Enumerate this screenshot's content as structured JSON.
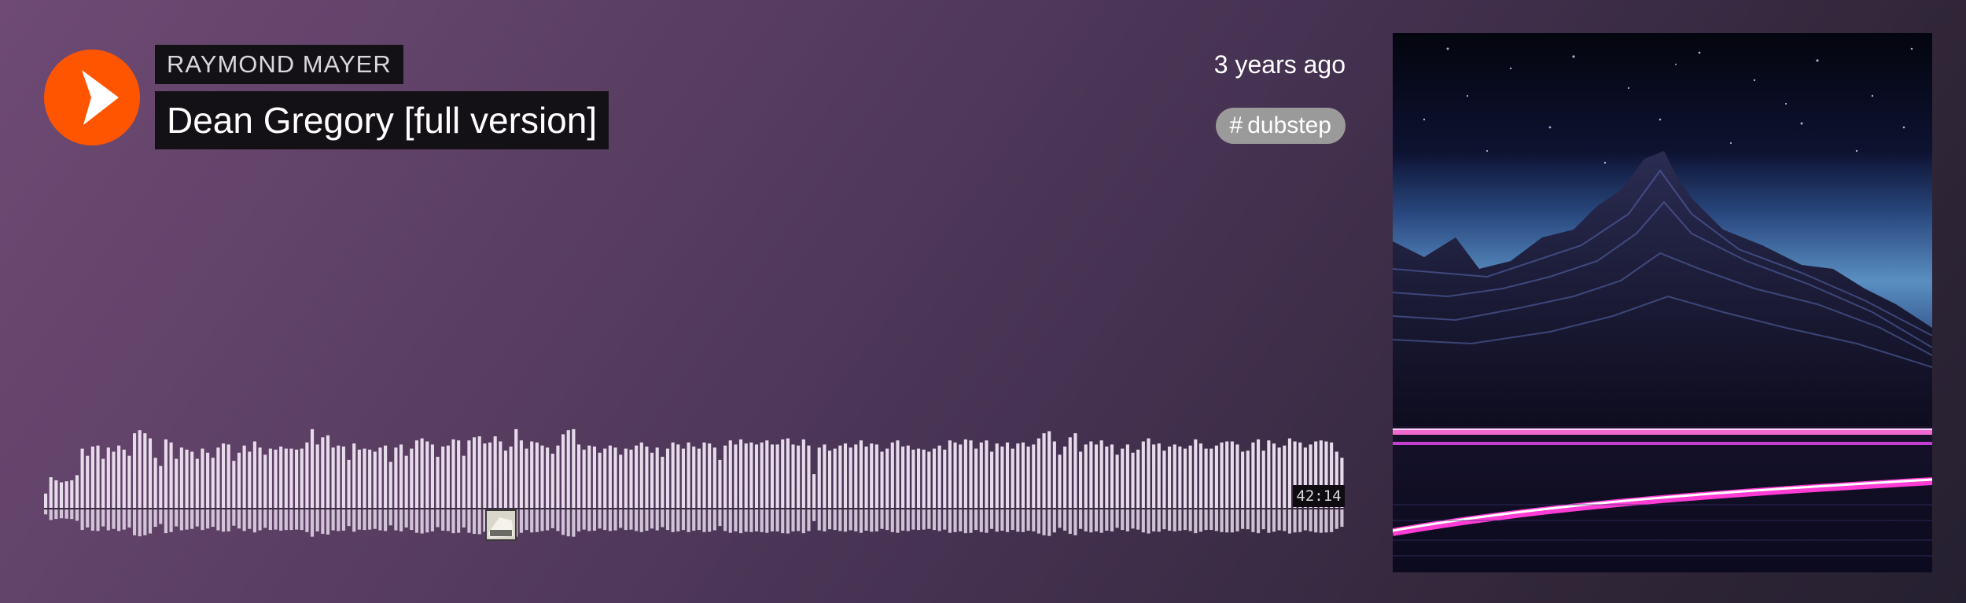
{
  "player": {
    "play_icon": "play-icon",
    "brand_color": "#ff5500"
  },
  "track": {
    "artist": "RAYMOND MAYER",
    "title": "Dean Gregory [full version]",
    "posted": "3 years ago",
    "tag": "dubstep",
    "tag_prefix": "#",
    "duration": "42:14"
  },
  "waveform": {
    "bar_color": "#e8dcec",
    "bars": [
      0.14,
      0.3,
      0.27,
      0.25,
      0.26,
      0.27,
      0.32,
      0.58,
      0.51,
      0.6,
      0.61,
      0.48,
      0.59,
      0.55,
      0.61,
      0.57,
      0.51,
      0.73,
      0.76,
      0.73,
      0.68,
      0.49,
      0.41,
      0.67,
      0.64,
      0.48,
      0.59,
      0.57,
      0.55,
      0.48,
      0.58,
      0.54,
      0.49,
      0.59,
      0.63,
      0.62,
      0.46,
      0.54,
      0.61,
      0.55,
      0.65,
      0.59,
      0.52,
      0.58,
      0.57,
      0.6,
      0.58,
      0.58,
      0.57,
      0.58,
      0.64,
      0.77,
      0.62,
      0.69,
      0.71,
      0.59,
      0.61,
      0.6,
      0.47,
      0.63,
      0.57,
      0.58,
      0.57,
      0.55,
      0.59,
      0.61,
      0.45,
      0.59,
      0.62,
      0.51,
      0.58,
      0.66,
      0.68,
      0.65,
      0.62,
      0.5,
      0.6,
      0.61,
      0.67,
      0.66,
      0.51,
      0.66,
      0.69,
      0.7,
      0.63,
      0.64,
      0.7,
      0.65,
      0.56,
      0.6,
      0.77,
      0.66,
      0.58,
      0.65,
      0.64,
      0.61,
      0.59,
      0.53,
      0.61,
      0.72,
      0.76,
      0.77,
      0.62,
      0.57,
      0.61,
      0.6,
      0.54,
      0.58,
      0.61,
      0.59,
      0.52,
      0.58,
      0.57,
      0.61,
      0.64,
      0.6,
      0.54,
      0.59,
      0.5,
      0.58,
      0.64,
      0.62,
      0.58,
      0.64,
      0.6,
      0.58,
      0.64,
      0.63,
      0.59,
      0.47,
      0.61,
      0.66,
      0.62,
      0.67,
      0.63,
      0.64,
      0.62,
      0.64,
      0.66,
      0.62,
      0.62,
      0.67,
      0.68,
      0.62,
      0.61,
      0.67,
      0.61,
      0.33,
      0.59,
      0.62,
      0.56,
      0.58,
      0.61,
      0.63,
      0.59,
      0.62,
      0.66,
      0.6,
      0.63,
      0.62,
      0.55,
      0.58,
      0.64,
      0.66,
      0.6,
      0.61,
      0.57,
      0.58,
      0.57,
      0.55,
      0.58,
      0.61,
      0.57,
      0.66,
      0.64,
      0.62,
      0.67,
      0.66,
      0.58,
      0.64,
      0.66,
      0.55,
      0.63,
      0.6,
      0.64,
      0.58,
      0.63,
      0.64,
      0.6,
      0.62,
      0.68,
      0.73,
      0.75,
      0.65,
      0.52,
      0.6,
      0.69,
      0.73,
      0.55,
      0.62,
      0.65,
      0.62,
      0.66,
      0.6,
      0.62,
      0.52,
      0.58,
      0.62,
      0.54,
      0.57,
      0.65,
      0.68,
      0.62,
      0.63,
      0.56,
      0.6,
      0.62,
      0.6,
      0.58,
      0.61,
      0.67,
      0.63,
      0.58,
      0.58,
      0.61,
      0.64,
      0.65,
      0.65,
      0.62,
      0.55,
      0.56,
      0.64,
      0.67,
      0.56,
      0.66,
      0.63,
      0.59,
      0.61,
      0.68,
      0.65,
      0.64,
      0.59,
      0.62,
      0.65,
      0.66,
      0.65,
      0.64,
      0.55,
      0.49
    ]
  },
  "artwork": {
    "description_icon": "album-artwork-synthwave-mountain"
  }
}
